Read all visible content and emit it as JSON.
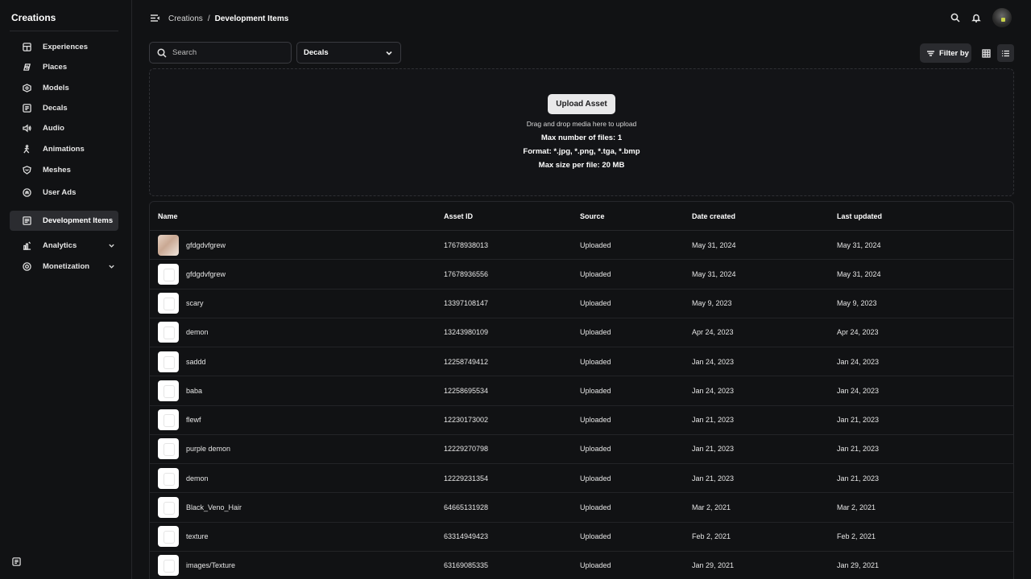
{
  "sidebar": {
    "title": "Creations",
    "items": [
      {
        "label": "Experiences",
        "icon": "experiences-icon"
      },
      {
        "label": "Places",
        "icon": "places-icon"
      },
      {
        "label": "Models",
        "icon": "models-icon"
      },
      {
        "label": "Decals",
        "icon": "decals-icon"
      },
      {
        "label": "Audio",
        "icon": "audio-icon"
      },
      {
        "label": "Animations",
        "icon": "animations-icon"
      },
      {
        "label": "Meshes",
        "icon": "meshes-icon"
      },
      {
        "label": "User Ads",
        "icon": "user-ads-icon"
      },
      {
        "label": "Development Items",
        "icon": "development-items-icon",
        "active": true
      },
      {
        "label": "Analytics",
        "icon": "analytics-icon",
        "expandable": true
      },
      {
        "label": "Monetization",
        "icon": "monetization-icon",
        "expandable": true
      }
    ]
  },
  "header": {
    "breadcrumb_parent": "Creations",
    "breadcrumb_sep": "/",
    "breadcrumb_current": "Development Items"
  },
  "toolbar": {
    "search_placeholder": "Search",
    "asset_type_selected": "Decals",
    "filter_label": "Filter by"
  },
  "dropzone": {
    "upload_label": "Upload Asset",
    "hint": "Drag and drop media here to upload",
    "max_files": "Max number of files: 1",
    "formats": "Format: *.jpg, *.png, *.tga, *.bmp",
    "max_size": "Max size per file: 20 MB"
  },
  "table": {
    "columns": [
      "Name",
      "Asset ID",
      "Source",
      "Date created",
      "Last updated"
    ],
    "rows": [
      {
        "name": "gfdgdvfgrew",
        "id": "17678938013",
        "source": "Uploaded",
        "created": "May 31, 2024",
        "updated": "May 31, 2024",
        "thumb": "photo"
      },
      {
        "name": "gfdgdvfgrew",
        "id": "17678936556",
        "source": "Uploaded",
        "created": "May 31, 2024",
        "updated": "May 31, 2024",
        "thumb": "blank"
      },
      {
        "name": "scary",
        "id": "13397108147",
        "source": "Uploaded",
        "created": "May 9, 2023",
        "updated": "May 9, 2023",
        "thumb": "blank"
      },
      {
        "name": "demon",
        "id": "13243980109",
        "source": "Uploaded",
        "created": "Apr 24, 2023",
        "updated": "Apr 24, 2023",
        "thumb": "blank"
      },
      {
        "name": "saddd",
        "id": "12258749412",
        "source": "Uploaded",
        "created": "Jan 24, 2023",
        "updated": "Jan 24, 2023",
        "thumb": "blank"
      },
      {
        "name": "baba",
        "id": "12258695534",
        "source": "Uploaded",
        "created": "Jan 24, 2023",
        "updated": "Jan 24, 2023",
        "thumb": "blank"
      },
      {
        "name": "flewf",
        "id": "12230173002",
        "source": "Uploaded",
        "created": "Jan 21, 2023",
        "updated": "Jan 21, 2023",
        "thumb": "blank"
      },
      {
        "name": "purple demon",
        "id": "12229270798",
        "source": "Uploaded",
        "created": "Jan 21, 2023",
        "updated": "Jan 21, 2023",
        "thumb": "blank"
      },
      {
        "name": "demon",
        "id": "12229231354",
        "source": "Uploaded",
        "created": "Jan 21, 2023",
        "updated": "Jan 21, 2023",
        "thumb": "blank"
      },
      {
        "name": "Black_Veno_Hair",
        "id": "64665131928",
        "source": "Uploaded",
        "created": "Mar 2, 2021",
        "updated": "Mar 2, 2021",
        "thumb": "blank"
      },
      {
        "name": "texture",
        "id": "63314949423",
        "source": "Uploaded",
        "created": "Feb 2, 2021",
        "updated": "Feb 2, 2021",
        "thumb": "blank"
      },
      {
        "name": "images/Texture",
        "id": "63169085335",
        "source": "Uploaded",
        "created": "Jan 29, 2021",
        "updated": "Jan 29, 2021",
        "thumb": "blank"
      }
    ]
  }
}
